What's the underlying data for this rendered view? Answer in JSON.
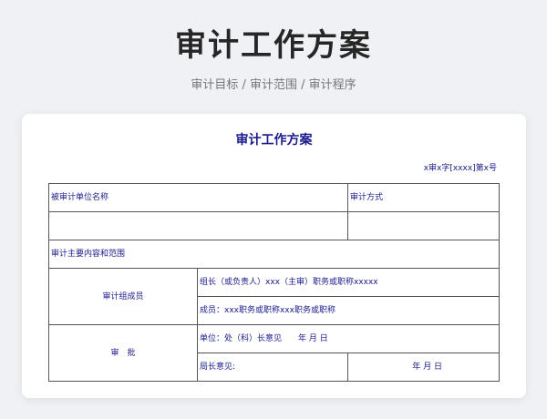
{
  "page": {
    "title": "审计工作方案",
    "subtitle": "审计目标 / 审计范围 / 审计程序"
  },
  "document": {
    "title": "审计工作方案",
    "number": "x审x字[xxxx]第x号",
    "form": {
      "audited_unit_label": "被审计单位名称",
      "audited_unit_value": "",
      "audit_method_label": "审计方式",
      "audit_method_value": "",
      "content_scope_label": "审计主要内容和范围",
      "team_label": "审计组成员",
      "team_leader_text": "组长（或负责人）xxx（主审）职务或职称xxxxx",
      "team_members_text": "成员：xxx职务或职称xxx职务或职称",
      "approval_label": "审　批",
      "unit_opinion_text": "单位：处（科）长意见　　年  月  日",
      "director_opinion_label": "局长意见:",
      "director_date_text": "年  月  日"
    }
  },
  "colors": {
    "background": "#eff1f4",
    "card": "#ffffff",
    "form_text": "#1a1a8c",
    "title_text": "#262626",
    "border": "#555555"
  }
}
